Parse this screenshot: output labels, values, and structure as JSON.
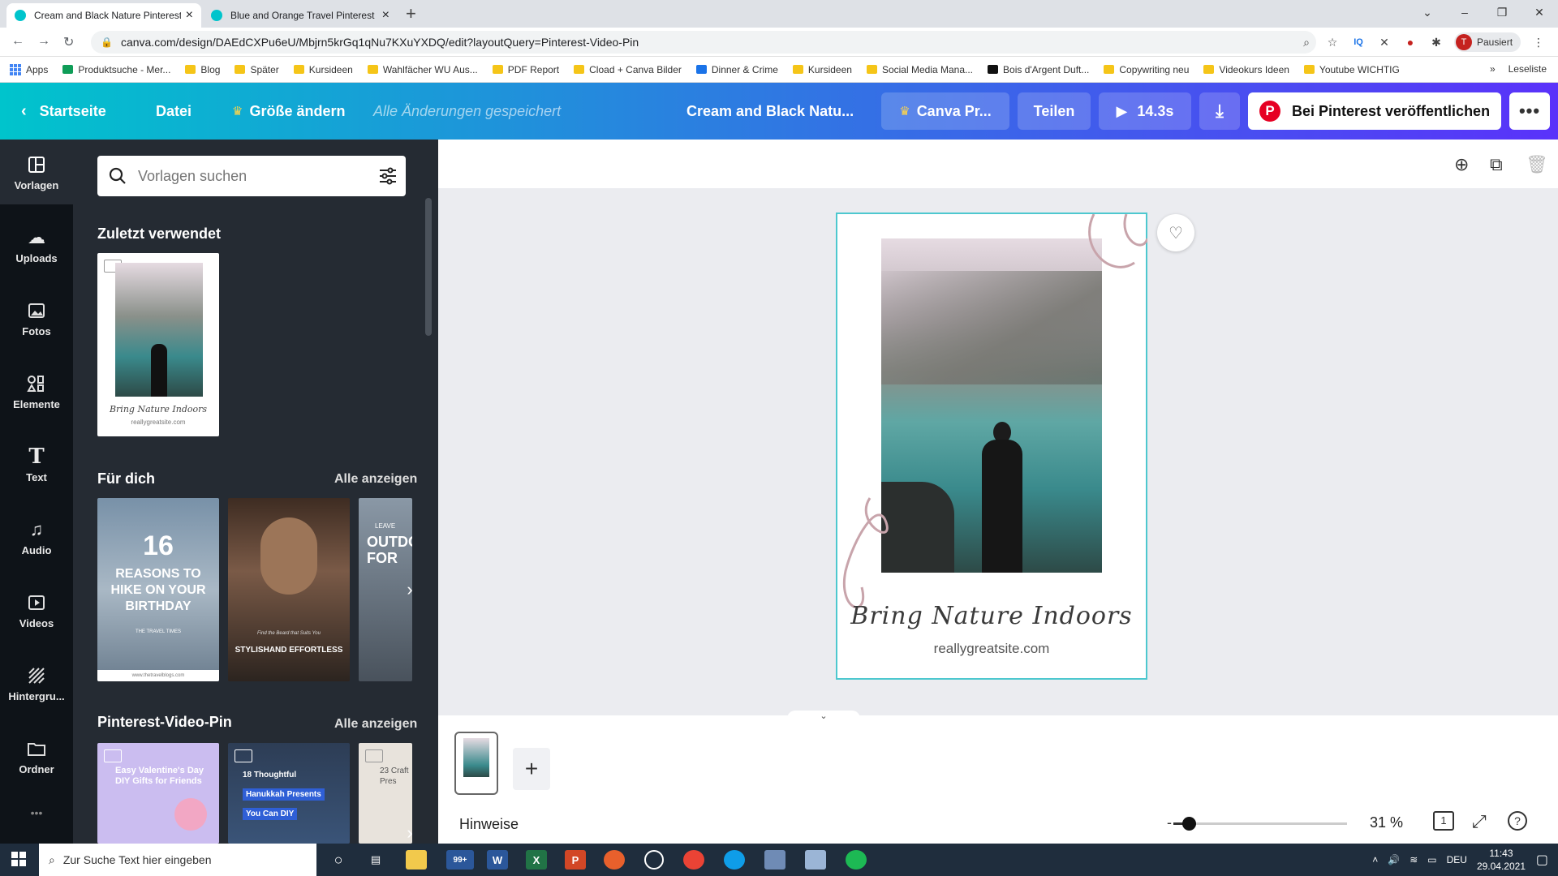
{
  "browser": {
    "tabs": [
      {
        "title": "Cream and Black Nature Pinterest",
        "active": true
      },
      {
        "title": "Blue and Orange Travel Pinterest",
        "active": false
      }
    ],
    "new_tab": "+",
    "url": "canva.com/design/DAEdCXPu6eU/Mbjrn5krGq1qNu7KXuYXDQ/edit?layoutQuery=Pinterest-Video-Pin",
    "profile_initial": "T",
    "profile_label": "Pausiert",
    "bookmarks": [
      "Apps",
      "Produktsuche - Mer...",
      "Blog",
      "Später",
      "Kursideen",
      "Wahlfächer WU Aus...",
      "PDF Report",
      "Cload + Canva Bilder",
      "Dinner & Crime",
      "Kursideen",
      "Social Media Mana...",
      "Bois d'Argent Duft...",
      "Copywriting neu",
      "Videokurs Ideen",
      "Youtube WICHTIG"
    ],
    "bookmarks_more": "»",
    "reading_list": "Leseliste"
  },
  "header": {
    "home": "Startseite",
    "file": "Datei",
    "resize": "Größe ändern",
    "saved_status": "Alle Änderungen gespeichert",
    "doc_title": "Cream and Black Natu...",
    "canva_pro": "Canva Pr...",
    "share": "Teilen",
    "duration": "14.3s",
    "publish": "Bei Pinterest veröffentlichen",
    "more": "•••"
  },
  "rail": [
    {
      "label": "Vorlagen",
      "icon": "templates-icon",
      "active": true
    },
    {
      "label": "Uploads",
      "icon": "upload-icon"
    },
    {
      "label": "Fotos",
      "icon": "photo-icon"
    },
    {
      "label": "Elemente",
      "icon": "elements-icon"
    },
    {
      "label": "Text",
      "icon": "text-icon"
    },
    {
      "label": "Audio",
      "icon": "audio-icon"
    },
    {
      "label": "Videos",
      "icon": "video-icon"
    },
    {
      "label": "Hintergru...",
      "icon": "background-icon"
    },
    {
      "label": "Ordner",
      "icon": "folder-icon"
    }
  ],
  "rail_more": "•••",
  "panel": {
    "search_placeholder": "Vorlagen suchen",
    "recent_title": "Zuletzt verwendet",
    "for_you_title": "Für dich",
    "for_you_see_all": "Alle anzeigen",
    "pin_title": "Pinterest-Video-Pin",
    "pin_see_all": "Alle anzeigen",
    "recent_card": {
      "script": "Bring Nature Indoors",
      "site": "reallygreatsite.com"
    },
    "for_you_cards": [
      {
        "big": "16",
        "text": "REASONS TO HIKE ON YOUR BIRTHDAY",
        "sub": "THE TRAVEL TIMES",
        "footer": "www.thetravelblogs.com"
      },
      {
        "small": "Find the Beard that Suits You",
        "text": "STYLISHAND EFFORTLESS"
      },
      {
        "top": "LEAVE",
        "text": "OUTDO FOR"
      }
    ],
    "pin_cards": [
      {
        "text": "Easy Valentine's Day DIY Gifts for Friends"
      },
      {
        "line1": "18 Thoughtful",
        "line2": "Hanukkah Presents",
        "line3": "You Can DIY"
      },
      {
        "text": "23 Craft Pres"
      }
    ]
  },
  "canvas": {
    "script_text": "Bring Nature Indoors",
    "site": "reallygreatsite.com"
  },
  "bottom": {
    "notes": "Hinweise",
    "zoom": "31 %",
    "zoom_level": 0.09,
    "pages": "1",
    "add": "+"
  },
  "taskbar": {
    "search_placeholder": "Zur Suche Text hier eingeben",
    "badge": "99+",
    "lang": "DEU",
    "time": "11:43",
    "date": "29.04.2021"
  },
  "colors": {
    "accent": "#00c4cc",
    "purple": "#5a32fa",
    "pinterest": "#e60023",
    "panel": "#252b33"
  }
}
